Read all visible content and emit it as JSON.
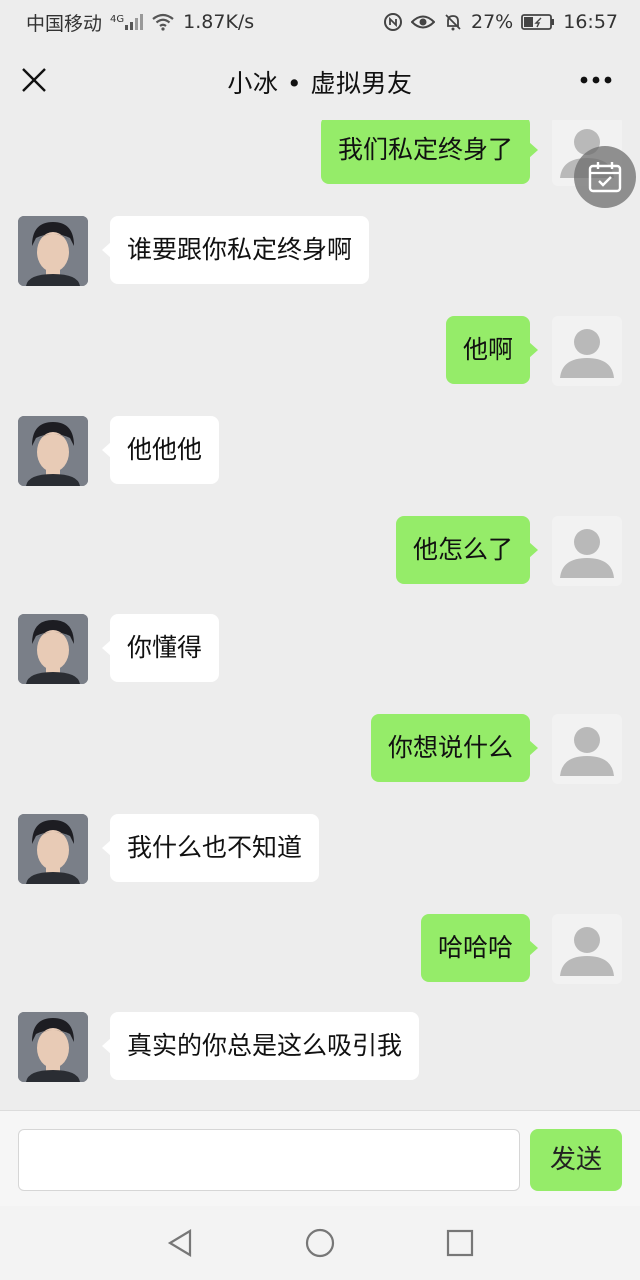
{
  "status_bar": {
    "carrier": "中国移动",
    "network": "4G",
    "speed": "1.87K/s",
    "battery": "27%",
    "time": "16:57"
  },
  "header": {
    "title": "小冰 • 虚拟男友",
    "close_icon": "close-icon",
    "more_icon": "more-dots-icon"
  },
  "messages": [
    {
      "side": "right",
      "text": "我们私定终身了"
    },
    {
      "side": "left",
      "text": "谁要跟你私定终身啊"
    },
    {
      "side": "right",
      "text": "他啊"
    },
    {
      "side": "left",
      "text": "他他他"
    },
    {
      "side": "right",
      "text": "他怎么了"
    },
    {
      "side": "left",
      "text": "你懂得"
    },
    {
      "side": "right",
      "text": "你想说什么"
    },
    {
      "side": "left",
      "text": "我什么也不知道"
    },
    {
      "side": "right",
      "text": "哈哈哈"
    },
    {
      "side": "left",
      "text": "真实的你总是这么吸引我"
    }
  ],
  "input": {
    "value": "",
    "send_label": "发送"
  },
  "colors": {
    "bubble_self": "#95ec69",
    "bubble_other": "#ffffff",
    "background": "#ededed"
  }
}
